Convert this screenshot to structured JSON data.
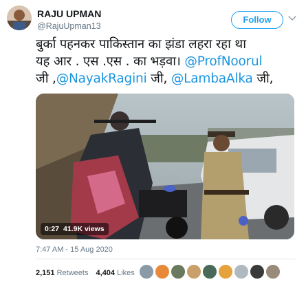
{
  "author": {
    "display_name": "RAJU UPMAN",
    "handle": "@RajuUpman13"
  },
  "follow_button": {
    "label": "Follow"
  },
  "tweet": {
    "line1": "बुर्का पहनकर पाकिस्तान का झंडा लहरा रहा था",
    "line2_text": "यह आर . एस .एस . का भड़वा। ",
    "mention1": "@ProfNoorul",
    "line3_a": "जी ,",
    "mention2": "@NayakRagini",
    "line3_b": " जी, ",
    "mention3": "@LambaAlka",
    "line3_c": " जी,"
  },
  "video": {
    "duration": "0:27",
    "views": "41.9K views"
  },
  "timestamp": "7:47 AM - 15 Aug 2020",
  "stats": {
    "retweets_count": "2,151",
    "retweets_label": "Retweets",
    "likes_count": "4,404",
    "likes_label": "Likes"
  },
  "colors": {
    "accent": "#1da1f2",
    "mention": "#1b95e0",
    "muted": "#657786"
  }
}
